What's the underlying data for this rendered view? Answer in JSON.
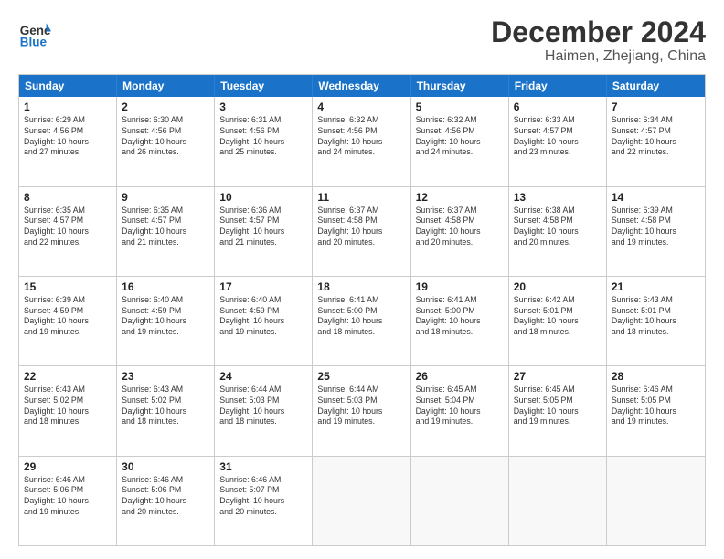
{
  "header": {
    "logo_line1": "General",
    "logo_line2": "Blue",
    "month_title": "December 2024",
    "location": "Haimen, Zhejiang, China"
  },
  "weekdays": [
    "Sunday",
    "Monday",
    "Tuesday",
    "Wednesday",
    "Thursday",
    "Friday",
    "Saturday"
  ],
  "weeks": [
    [
      {
        "day": "1",
        "lines": [
          "Sunrise: 6:29 AM",
          "Sunset: 4:56 PM",
          "Daylight: 10 hours",
          "and 27 minutes."
        ]
      },
      {
        "day": "2",
        "lines": [
          "Sunrise: 6:30 AM",
          "Sunset: 4:56 PM",
          "Daylight: 10 hours",
          "and 26 minutes."
        ]
      },
      {
        "day": "3",
        "lines": [
          "Sunrise: 6:31 AM",
          "Sunset: 4:56 PM",
          "Daylight: 10 hours",
          "and 25 minutes."
        ]
      },
      {
        "day": "4",
        "lines": [
          "Sunrise: 6:32 AM",
          "Sunset: 4:56 PM",
          "Daylight: 10 hours",
          "and 24 minutes."
        ]
      },
      {
        "day": "5",
        "lines": [
          "Sunrise: 6:32 AM",
          "Sunset: 4:56 PM",
          "Daylight: 10 hours",
          "and 24 minutes."
        ]
      },
      {
        "day": "6",
        "lines": [
          "Sunrise: 6:33 AM",
          "Sunset: 4:57 PM",
          "Daylight: 10 hours",
          "and 23 minutes."
        ]
      },
      {
        "day": "7",
        "lines": [
          "Sunrise: 6:34 AM",
          "Sunset: 4:57 PM",
          "Daylight: 10 hours",
          "and 22 minutes."
        ]
      }
    ],
    [
      {
        "day": "8",
        "lines": [
          "Sunrise: 6:35 AM",
          "Sunset: 4:57 PM",
          "Daylight: 10 hours",
          "and 22 minutes."
        ]
      },
      {
        "day": "9",
        "lines": [
          "Sunrise: 6:35 AM",
          "Sunset: 4:57 PM",
          "Daylight: 10 hours",
          "and 21 minutes."
        ]
      },
      {
        "day": "10",
        "lines": [
          "Sunrise: 6:36 AM",
          "Sunset: 4:57 PM",
          "Daylight: 10 hours",
          "and 21 minutes."
        ]
      },
      {
        "day": "11",
        "lines": [
          "Sunrise: 6:37 AM",
          "Sunset: 4:58 PM",
          "Daylight: 10 hours",
          "and 20 minutes."
        ]
      },
      {
        "day": "12",
        "lines": [
          "Sunrise: 6:37 AM",
          "Sunset: 4:58 PM",
          "Daylight: 10 hours",
          "and 20 minutes."
        ]
      },
      {
        "day": "13",
        "lines": [
          "Sunrise: 6:38 AM",
          "Sunset: 4:58 PM",
          "Daylight: 10 hours",
          "and 20 minutes."
        ]
      },
      {
        "day": "14",
        "lines": [
          "Sunrise: 6:39 AM",
          "Sunset: 4:58 PM",
          "Daylight: 10 hours",
          "and 19 minutes."
        ]
      }
    ],
    [
      {
        "day": "15",
        "lines": [
          "Sunrise: 6:39 AM",
          "Sunset: 4:59 PM",
          "Daylight: 10 hours",
          "and 19 minutes."
        ]
      },
      {
        "day": "16",
        "lines": [
          "Sunrise: 6:40 AM",
          "Sunset: 4:59 PM",
          "Daylight: 10 hours",
          "and 19 minutes."
        ]
      },
      {
        "day": "17",
        "lines": [
          "Sunrise: 6:40 AM",
          "Sunset: 4:59 PM",
          "Daylight: 10 hours",
          "and 19 minutes."
        ]
      },
      {
        "day": "18",
        "lines": [
          "Sunrise: 6:41 AM",
          "Sunset: 5:00 PM",
          "Daylight: 10 hours",
          "and 18 minutes."
        ]
      },
      {
        "day": "19",
        "lines": [
          "Sunrise: 6:41 AM",
          "Sunset: 5:00 PM",
          "Daylight: 10 hours",
          "and 18 minutes."
        ]
      },
      {
        "day": "20",
        "lines": [
          "Sunrise: 6:42 AM",
          "Sunset: 5:01 PM",
          "Daylight: 10 hours",
          "and 18 minutes."
        ]
      },
      {
        "day": "21",
        "lines": [
          "Sunrise: 6:43 AM",
          "Sunset: 5:01 PM",
          "Daylight: 10 hours",
          "and 18 minutes."
        ]
      }
    ],
    [
      {
        "day": "22",
        "lines": [
          "Sunrise: 6:43 AM",
          "Sunset: 5:02 PM",
          "Daylight: 10 hours",
          "and 18 minutes."
        ]
      },
      {
        "day": "23",
        "lines": [
          "Sunrise: 6:43 AM",
          "Sunset: 5:02 PM",
          "Daylight: 10 hours",
          "and 18 minutes."
        ]
      },
      {
        "day": "24",
        "lines": [
          "Sunrise: 6:44 AM",
          "Sunset: 5:03 PM",
          "Daylight: 10 hours",
          "and 18 minutes."
        ]
      },
      {
        "day": "25",
        "lines": [
          "Sunrise: 6:44 AM",
          "Sunset: 5:03 PM",
          "Daylight: 10 hours",
          "and 19 minutes."
        ]
      },
      {
        "day": "26",
        "lines": [
          "Sunrise: 6:45 AM",
          "Sunset: 5:04 PM",
          "Daylight: 10 hours",
          "and 19 minutes."
        ]
      },
      {
        "day": "27",
        "lines": [
          "Sunrise: 6:45 AM",
          "Sunset: 5:05 PM",
          "Daylight: 10 hours",
          "and 19 minutes."
        ]
      },
      {
        "day": "28",
        "lines": [
          "Sunrise: 6:46 AM",
          "Sunset: 5:05 PM",
          "Daylight: 10 hours",
          "and 19 minutes."
        ]
      }
    ],
    [
      {
        "day": "29",
        "lines": [
          "Sunrise: 6:46 AM",
          "Sunset: 5:06 PM",
          "Daylight: 10 hours",
          "and 19 minutes."
        ]
      },
      {
        "day": "30",
        "lines": [
          "Sunrise: 6:46 AM",
          "Sunset: 5:06 PM",
          "Daylight: 10 hours",
          "and 20 minutes."
        ]
      },
      {
        "day": "31",
        "lines": [
          "Sunrise: 6:46 AM",
          "Sunset: 5:07 PM",
          "Daylight: 10 hours",
          "and 20 minutes."
        ]
      },
      {
        "day": "",
        "lines": []
      },
      {
        "day": "",
        "lines": []
      },
      {
        "day": "",
        "lines": []
      },
      {
        "day": "",
        "lines": []
      }
    ]
  ]
}
